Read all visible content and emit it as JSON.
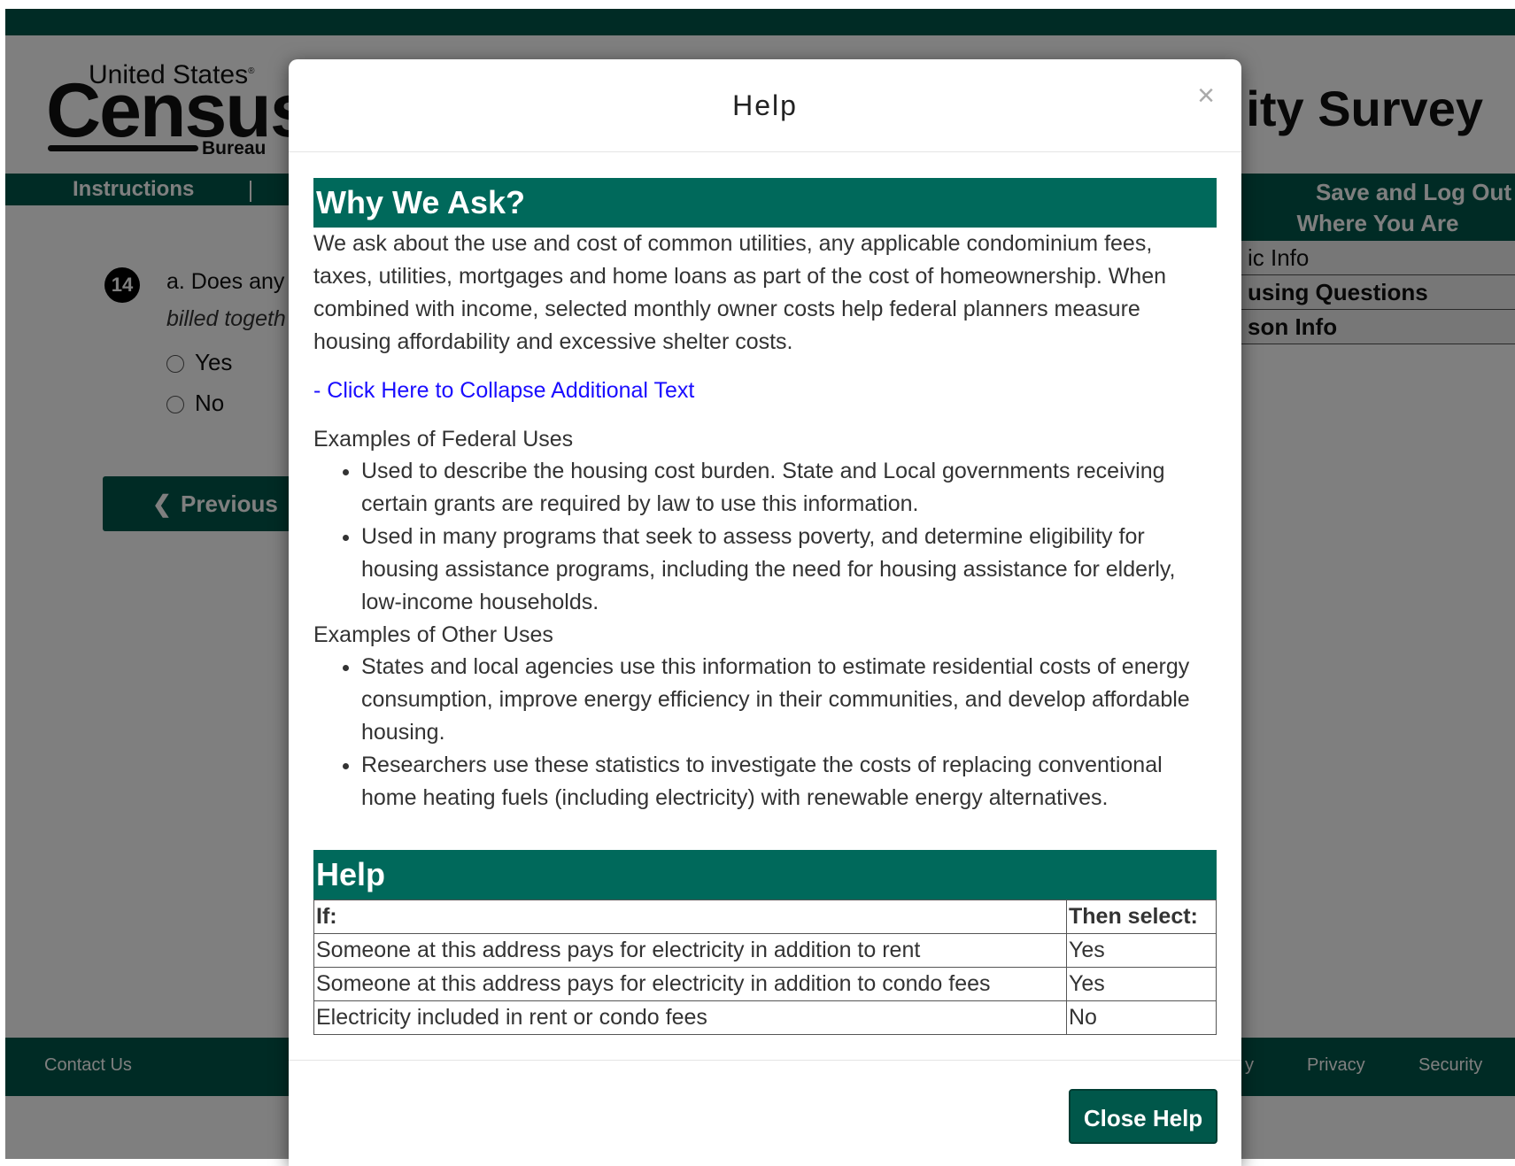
{
  "page": {
    "logo_top": "United States",
    "logo_main": "Census",
    "logo_bureau": "Bureau",
    "survey_title": "ity Survey",
    "nav": {
      "instructions": "Instructions",
      "save_logout": "Save and Log Out"
    },
    "where_you_are": {
      "header": "Where You Are",
      "items": [
        "ic Info",
        "using Questions",
        "son Info"
      ]
    },
    "question": {
      "number": "14",
      "text": "a. Does any",
      "subtext": "billed togeth",
      "options": [
        "Yes",
        "No"
      ]
    },
    "previous_button": "Previous",
    "footer": {
      "contact": "Contact Us",
      "partial": "y",
      "privacy": "Privacy",
      "security": "Security"
    }
  },
  "modal": {
    "title": "Help",
    "close_symbol": "×",
    "why_header": "Why We Ask?",
    "why_text": "We ask about the use and cost of common utilities, any applicable condominium fees, taxes, utilities, mortgages and home loans as part of the cost of homeownership. When combined with income, selected monthly owner costs help federal planners measure housing affordability and excessive shelter costs.",
    "collapse_link": "- Click Here to Collapse Additional Text",
    "federal_head": "Examples of Federal Uses",
    "federal_uses": [
      "Used to describe the housing cost burden. State and Local governments receiving certain grants are required by law to use this information.",
      "Used in many programs that seek to assess poverty, and determine eligibility for housing assistance programs, including the need for housing assistance for elderly, low-income households."
    ],
    "other_head": "Examples of Other Uses",
    "other_uses": [
      "States and local agencies use this information to estimate residential costs of energy consumption, improve energy efficiency in their communities, and develop affordable housing.",
      "Researchers use these statistics to investigate the costs of replacing conventional home heating fuels (including electricity) with renewable energy alternatives."
    ],
    "help_header": "Help",
    "table": {
      "headers": [
        "If:",
        "Then select:"
      ],
      "rows": [
        [
          "Someone at this address pays for electricity in addition to rent",
          "Yes"
        ],
        [
          "Someone at this address pays for electricity in addition to condo fees",
          "Yes"
        ],
        [
          "Electricity included in rent or condo fees",
          "No"
        ]
      ]
    },
    "close_button": "Close Help"
  }
}
